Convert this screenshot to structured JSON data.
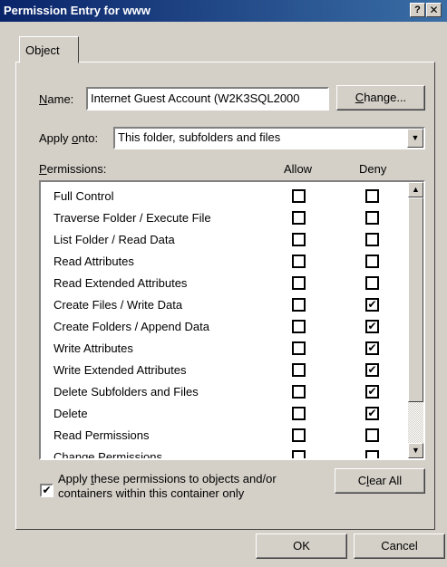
{
  "window": {
    "title": "Permission Entry for www",
    "help_label": "?",
    "close_label": "✕"
  },
  "tab": {
    "label": "Object"
  },
  "name_field": {
    "label_prefix": "",
    "label_underlined": "N",
    "label_rest": "ame:",
    "value": "Internet Guest Account (W2K3SQL2000"
  },
  "change_button": {
    "underlined": "C",
    "rest": "hange..."
  },
  "apply_onto": {
    "label_a": "Apply ",
    "label_underlined": "o",
    "label_b": "nto:",
    "value": "This folder, subfolders and files",
    "arrow": "▼"
  },
  "permissions": {
    "label_underlined": "P",
    "label_rest": "ermissions:",
    "allow_header": "Allow",
    "deny_header": "Deny",
    "rows": [
      {
        "name": "Full Control",
        "allow": false,
        "deny": false
      },
      {
        "name": "Traverse Folder / Execute File",
        "allow": false,
        "deny": false
      },
      {
        "name": "List Folder / Read Data",
        "allow": false,
        "deny": false
      },
      {
        "name": "Read Attributes",
        "allow": false,
        "deny": false
      },
      {
        "name": "Read Extended Attributes",
        "allow": false,
        "deny": false
      },
      {
        "name": "Create Files / Write Data",
        "allow": false,
        "deny": true
      },
      {
        "name": "Create Folders / Append Data",
        "allow": false,
        "deny": true
      },
      {
        "name": "Write Attributes",
        "allow": false,
        "deny": true
      },
      {
        "name": "Write Extended Attributes",
        "allow": false,
        "deny": true
      },
      {
        "name": "Delete Subfolders and Files",
        "allow": false,
        "deny": true
      },
      {
        "name": "Delete",
        "allow": false,
        "deny": true
      },
      {
        "name": "Read Permissions",
        "allow": false,
        "deny": false
      },
      {
        "name": "Change Permissions",
        "allow": false,
        "deny": false
      }
    ],
    "scroll_up": "▲",
    "scroll_down": "▼"
  },
  "apply_containers": {
    "checked": true,
    "line1_a": "Apply ",
    "line1_underlined": "t",
    "line1_b": "hese permissions to objects and/or",
    "line2": "containers within this container only"
  },
  "clear_all_button": {
    "a": "C",
    "underlined": "l",
    "b": "ear All"
  },
  "ok_button": "OK",
  "cancel_button": "Cancel",
  "check_glyph": "✔"
}
